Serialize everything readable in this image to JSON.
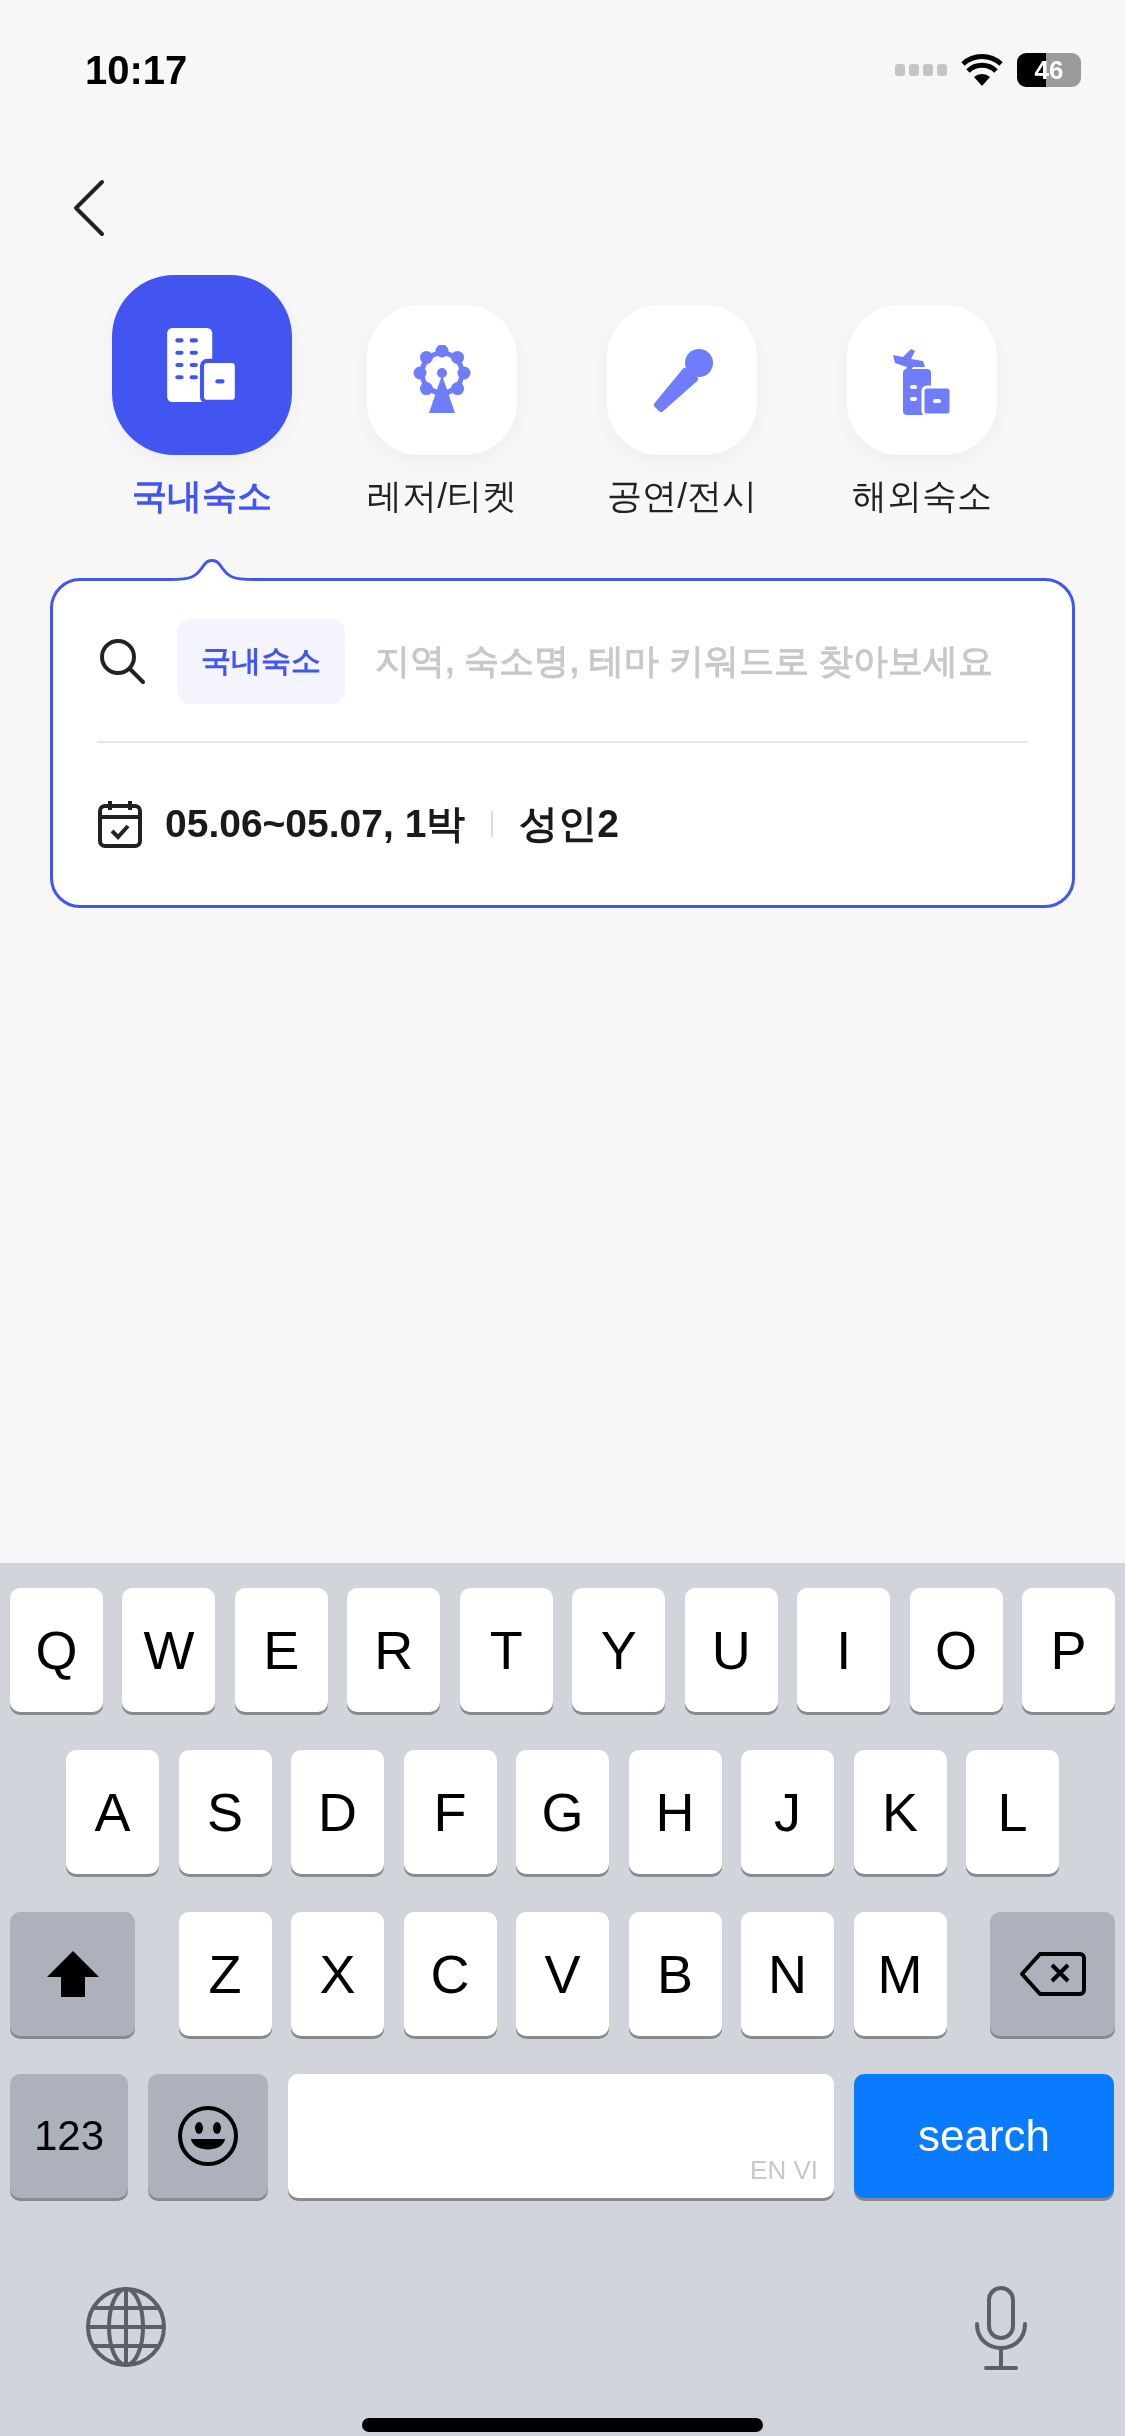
{
  "status_bar": {
    "time": "10:17",
    "battery": "46"
  },
  "categories": [
    {
      "kind": "building",
      "label": "국내숙소",
      "selected": true
    },
    {
      "kind": "ferris-wheel",
      "label": "레저/티켓",
      "selected": false
    },
    {
      "kind": "microphone",
      "label": "공연/전시",
      "selected": false
    },
    {
      "kind": "plane-building",
      "label": "해외숙소",
      "selected": false
    }
  ],
  "search_card": {
    "chip": "국내숙소",
    "placeholder": "지역, 숙소명, 테마 키워드로 찾아보세요",
    "dates": "05.06~05.07, 1박",
    "guests": "성인2"
  },
  "keyboard": {
    "letter_rows": [
      [
        "Q",
        "W",
        "E",
        "R",
        "T",
        "Y",
        "U",
        "I",
        "O",
        "P"
      ],
      [
        "A",
        "S",
        "D",
        "F",
        "G",
        "H",
        "J",
        "K",
        "L"
      ],
      [
        "Z",
        "X",
        "C",
        "V",
        "B",
        "N",
        "M"
      ]
    ],
    "mode_key": "123",
    "space_hint": "EN VI",
    "action_key": "search"
  }
}
